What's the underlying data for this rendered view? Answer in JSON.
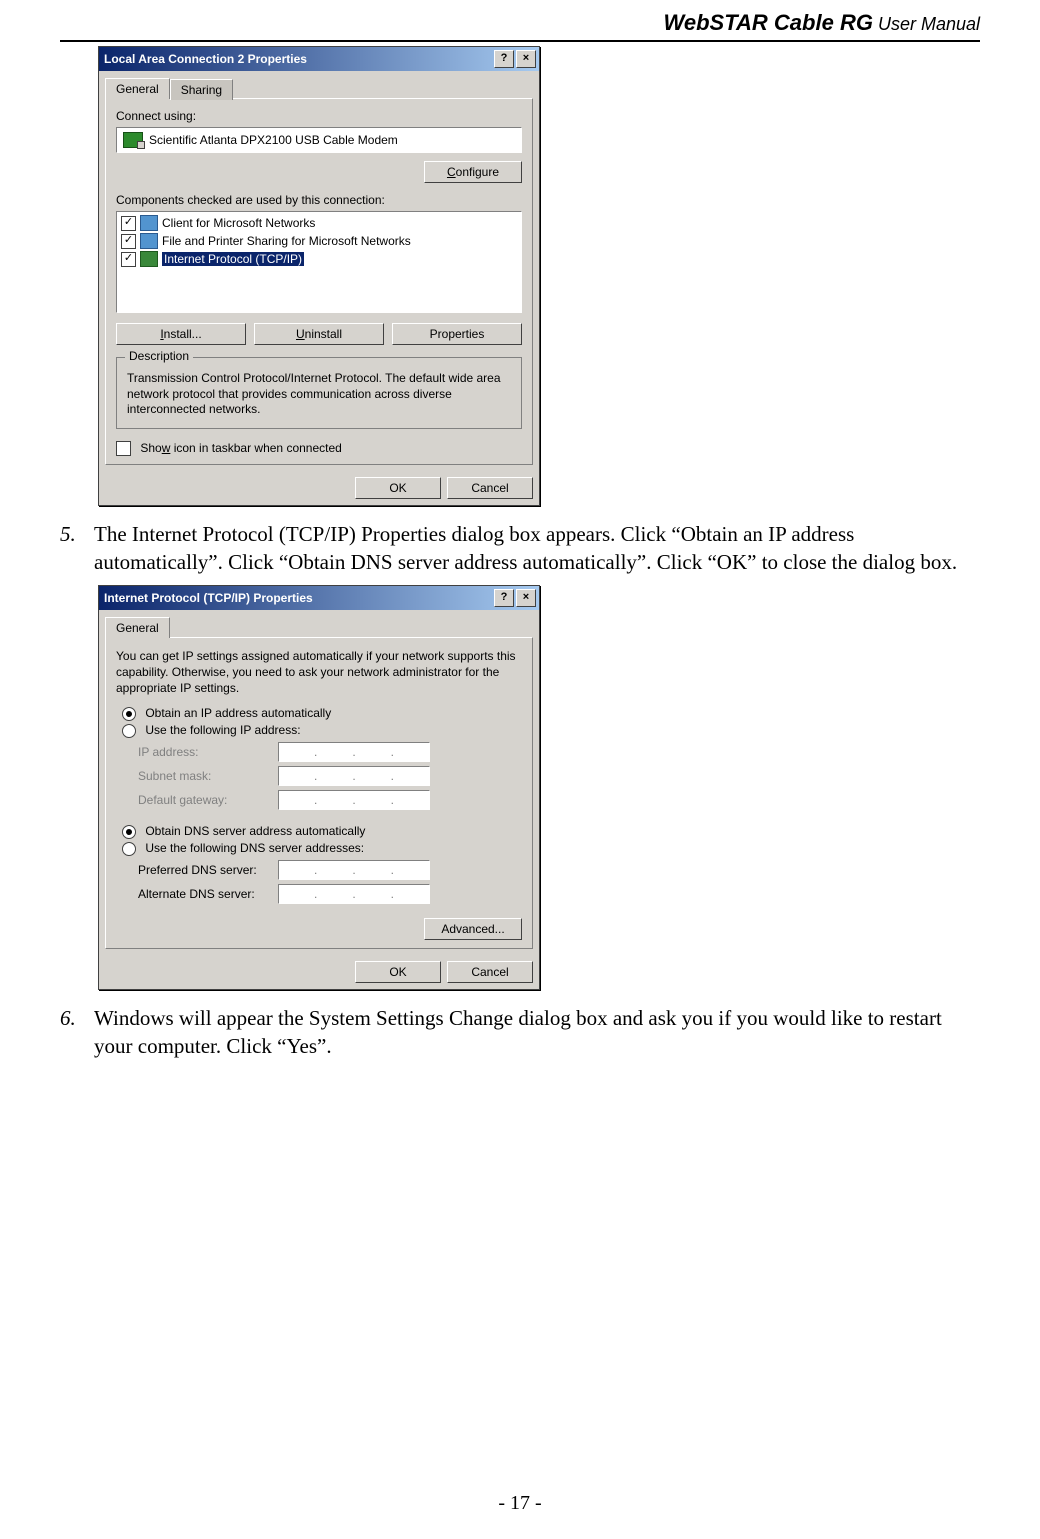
{
  "header": {
    "product": "WebSTAR Cable RG",
    "suffix": " User Manual"
  },
  "dialog1": {
    "title": "Local Area Connection 2 Properties",
    "help_glyph": "?",
    "close_glyph": "×",
    "tabs": {
      "general": "General",
      "sharing": "Sharing"
    },
    "connect_using_label": "Connect using:",
    "adapter": "Scientific Atlanta DPX2100 USB Cable Modem",
    "configure_btn": "Configure",
    "components_label": "Components checked are used by this connection:",
    "components": {
      "c0": "Client for Microsoft Networks",
      "c1": "File and Printer Sharing for Microsoft Networks",
      "c2": "Internet Protocol (TCP/IP)"
    },
    "install_btn": "Install...",
    "uninstall_btn": "Uninstall",
    "properties_btn": "Properties",
    "description_legend": "Description",
    "description_text": "Transmission Control Protocol/Internet Protocol. The default wide area network protocol that provides communication across diverse interconnected networks.",
    "show_icon_label": "Show icon in taskbar when connected",
    "ok_btn": "OK",
    "cancel_btn": "Cancel"
  },
  "step5": {
    "num": "5.",
    "text": "The Internet Protocol (TCP/IP) Properties dialog box appears. Click “Obtain an IP address automatically”. Click “Obtain DNS server address automatically”. Click “OK” to close the dialog box."
  },
  "dialog2": {
    "title": "Internet Protocol (TCP/IP) Properties",
    "help_glyph": "?",
    "close_glyph": "×",
    "tab_general": "General",
    "intro": "You can get IP settings assigned automatically if your network supports this capability. Otherwise, you need to ask your network administrator for the appropriate IP settings.",
    "radios": {
      "obtain_ip": "Obtain an IP address automatically",
      "use_ip": "Use the following IP address:",
      "obtain_dns": "Obtain DNS server address automatically",
      "use_dns": "Use the following DNS server addresses:"
    },
    "fields": {
      "ip": "IP address:",
      "subnet": "Subnet mask:",
      "gateway": "Default gateway:",
      "pref_dns": "Preferred DNS server:",
      "alt_dns": "Alternate DNS server:"
    },
    "advanced_btn": "Advanced...",
    "ok_btn": "OK",
    "cancel_btn": "Cancel"
  },
  "step6": {
    "num": "6.",
    "text": "Windows will appear the System Settings Change dialog box and ask you if you would like to restart your computer. Click “Yes”."
  },
  "footer": "- 17 -"
}
